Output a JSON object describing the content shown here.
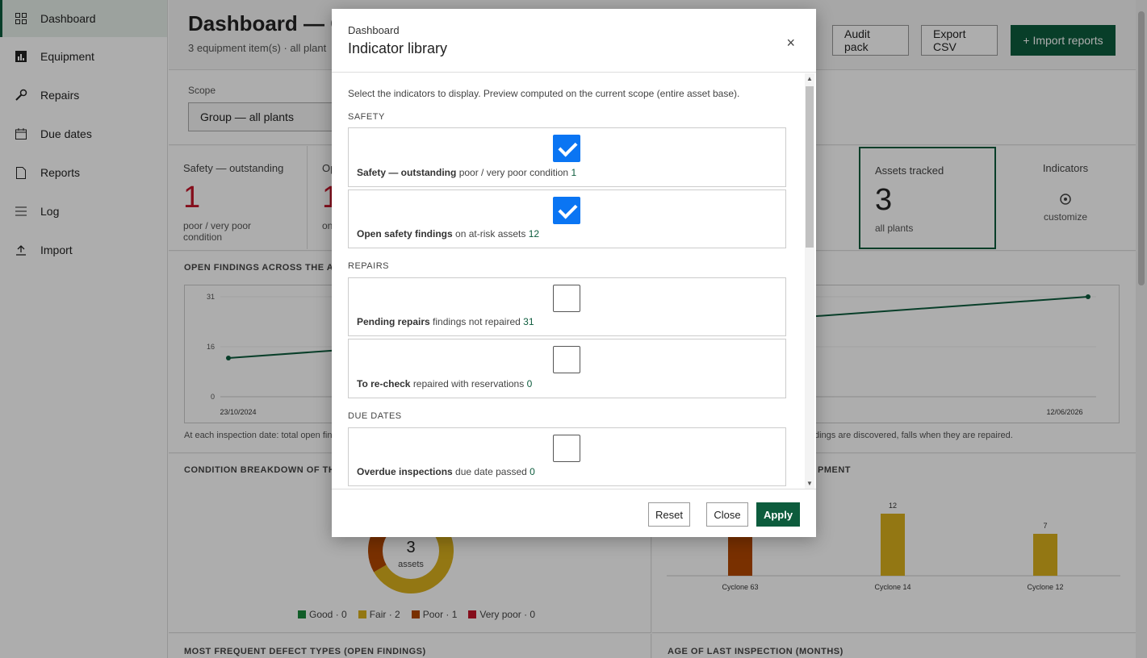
{
  "sidebar": {
    "items": [
      {
        "label": "Dashboard",
        "icon": "grid-icon"
      },
      {
        "label": "Equipment",
        "icon": "chart-icon"
      },
      {
        "label": "Repairs",
        "icon": "wrench-icon"
      },
      {
        "label": "Due dates",
        "icon": "calendar-icon"
      },
      {
        "label": "Reports",
        "icon": "document-icon"
      },
      {
        "label": "Log",
        "icon": "list-icon"
      },
      {
        "label": "Import",
        "icon": "upload-icon"
      }
    ]
  },
  "header": {
    "title": "Dashboard — G",
    "subtitle": "3 equipment item(s) · all plant",
    "audit_label": "Audit pack",
    "export_label": "Export CSV",
    "import_label": "+ Import reports"
  },
  "scope": {
    "label": "Scope",
    "value": "Group — all plants"
  },
  "kpis": {
    "safety": {
      "label": "Safety — outstanding",
      "value": "1",
      "note": "poor / very poor condition"
    },
    "open_partial": {
      "label": "Op",
      "value": "1",
      "note": "on"
    },
    "assets": {
      "label": "Assets tracked",
      "value": "3",
      "note": "all plants"
    },
    "indicators": {
      "label": "Indicators",
      "note": "customize"
    }
  },
  "panels": {
    "findings_title": "OPEN FINDINGS ACROSS THE ASS",
    "findings_caption_left": "At each inspection date: total open fin",
    "findings_caption_right": "dings are discovered, falls when they are repaired.",
    "condition_title": "CONDITION BREAKDOWN OF THE",
    "equipment_title_right": "PMENT",
    "defects_title": "MOST FREQUENT DEFECT TYPES (OPEN FINDINGS)",
    "age_title": "AGE OF LAST INSPECTION (MONTHS)",
    "donut_value": "3",
    "donut_label": "assets"
  },
  "condition_legend": [
    {
      "label": "Good · 0",
      "color": "#1a8a3c"
    },
    {
      "label": "Fair · 2",
      "color": "#d9b01c"
    },
    {
      "label": "Poor · 1",
      "color": "#b34700"
    },
    {
      "label": "Very poor · 0",
      "color": "#c4162a"
    }
  ],
  "chart_data": [
    {
      "type": "line",
      "title": "OPEN FINDINGS ACROSS THE ASS",
      "x": [
        "23/10/2024",
        "12/06/2026"
      ],
      "series": [
        {
          "values": [
            12,
            31
          ]
        }
      ],
      "yticks": [
        0,
        16,
        31
      ],
      "ylim": [
        0,
        31
      ],
      "color": "#0d5c3d"
    },
    {
      "type": "bar",
      "categories": [
        "Cyclone 63",
        "Cyclone 14",
        "Cyclone 12"
      ],
      "values": [
        12,
        7
      ],
      "value_labels": [
        "12",
        "7"
      ],
      "colors": [
        "#b34700",
        "#d9b01c",
        "#d9b01c"
      ]
    },
    {
      "type": "pie",
      "center_value": "3",
      "center_label": "assets",
      "slices": [
        {
          "label": "Good",
          "value": 0,
          "color": "#1a8a3c"
        },
        {
          "label": "Fair",
          "value": 2,
          "color": "#d9b01c"
        },
        {
          "label": "Poor",
          "value": 1,
          "color": "#b34700"
        },
        {
          "label": "Very poor",
          "value": 0,
          "color": "#c4162a"
        }
      ]
    }
  ],
  "modal": {
    "kicker": "Dashboard",
    "title": "Indicator library",
    "close_glyph": "×",
    "intro": "Select the indicators to display. Preview computed on the current scope (entire asset base).",
    "sections": {
      "safety": "SAFETY",
      "repairs": "REPAIRS",
      "due": "DUE DATES"
    },
    "indicators": [
      {
        "name": "Safety — outstanding",
        "desc": "poor / very poor condition",
        "count": "1",
        "checked": true
      },
      {
        "name": "Open safety findings",
        "desc": "on at-risk assets",
        "count": "12",
        "checked": true
      },
      {
        "name": "Pending repairs",
        "desc": "findings not repaired",
        "count": "31",
        "checked": false
      },
      {
        "name": "To re-check",
        "desc": "repaired with reservations",
        "count": "0",
        "checked": false
      },
      {
        "name": "Overdue inspections",
        "desc": "due date passed",
        "count": "0",
        "checked": false
      }
    ],
    "reset_label": "Reset",
    "close_label": "Close",
    "apply_label": "Apply"
  },
  "colors": {
    "accent": "#0d5c3d",
    "check": "#0a75f3",
    "danger": "#c4162a"
  }
}
